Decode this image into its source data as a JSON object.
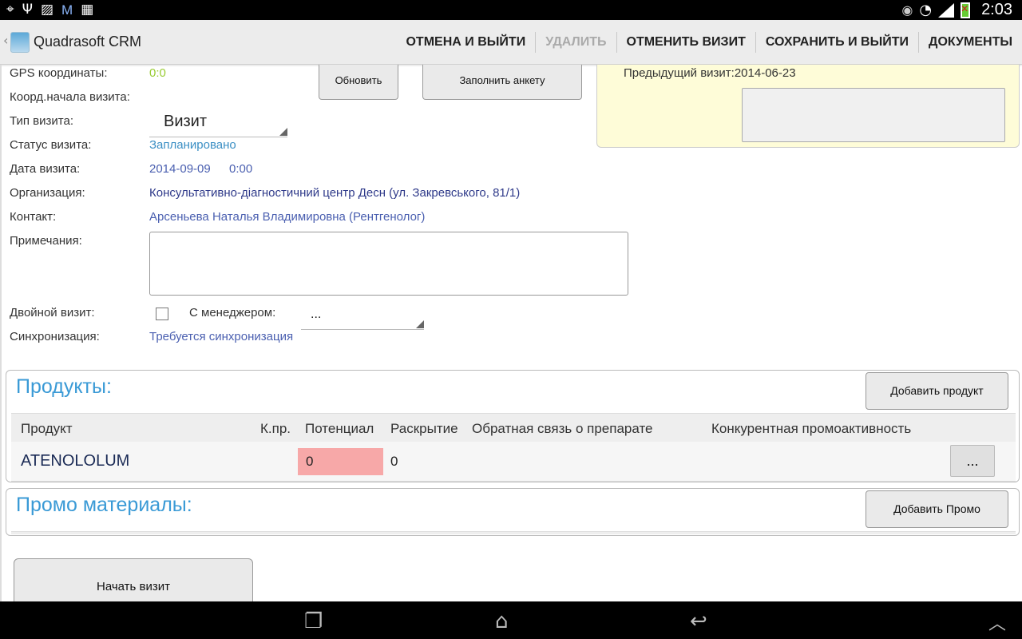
{
  "status_bar": {
    "time": "2:03",
    "left_icons": [
      "gps-icon",
      "usb-icon",
      "image-icon",
      "gmail-icon",
      "calculator-icon"
    ],
    "right_icons": [
      "eye-icon",
      "wifi-icon",
      "signal-icon",
      "battery-icon"
    ]
  },
  "action_bar": {
    "title": "Quadrasoft CRM",
    "actions": [
      {
        "label": "ОТМЕНА И ВЫЙТИ",
        "enabled": true
      },
      {
        "label": "УДАЛИТЬ",
        "enabled": false
      },
      {
        "label": "ОТМЕНИТЬ ВИЗИТ",
        "enabled": true
      },
      {
        "label": "СОХРАНИТЬ И ВЫЙТИ",
        "enabled": true
      },
      {
        "label": "ДОКУМЕНТЫ",
        "enabled": true
      }
    ]
  },
  "form": {
    "gps_label": "GPS координаты:",
    "gps_value": "0:0",
    "coords_label": "Коорд.начала визита:",
    "refresh_button": "Обновить",
    "survey_button": "Заполнить анкету",
    "visit_type_label": "Тип визита:",
    "visit_type_value": "Визит",
    "visit_status_label": "Статус визита:",
    "visit_status_value": "Запланировано",
    "visit_date_label": "Дата визита:",
    "visit_date_value": "2014-09-09",
    "visit_time_value": "0:00",
    "org_label": "Организация:",
    "org_value": "Консультативно-діагностичний центр Десн (ул. Закревського, 81/1)",
    "contact_label": "Контакт:",
    "contact_value": "Арсеньева Наталья Владимировна (Рентгенолог)",
    "notes_label": "Примечания:",
    "double_visit_label": "Двойной визит:",
    "manager_label": "С менеджером:",
    "manager_value": "...",
    "sync_label": "Синхронизация:",
    "sync_value": "Требуется синхронизация",
    "previous_visit": "Предыдущий визит:2014-06-23"
  },
  "products": {
    "title": "Продукты:",
    "add_button": "Добавить продукт",
    "columns": [
      "Продукт",
      "К.пр.",
      "Потенциал",
      "Раскрытие",
      "Обратная связь о препарате",
      "Конкурентная промоактивность"
    ],
    "rows": [
      {
        "product": "ATENOLOLUM",
        "kpr": "",
        "potential": "0",
        "disclosure": "0",
        "feedback": "",
        "competitor": "",
        "more": "..."
      }
    ],
    "potential_highlight": "#f7a8a8"
  },
  "promo": {
    "title": "Промо материалы:",
    "add_button": "Добавить Промо"
  },
  "start_visit_button": "Начать визит",
  "nav_bar": {
    "icons": [
      "recent-apps-icon",
      "home-icon",
      "back-icon",
      "chevron-up-icon"
    ]
  }
}
